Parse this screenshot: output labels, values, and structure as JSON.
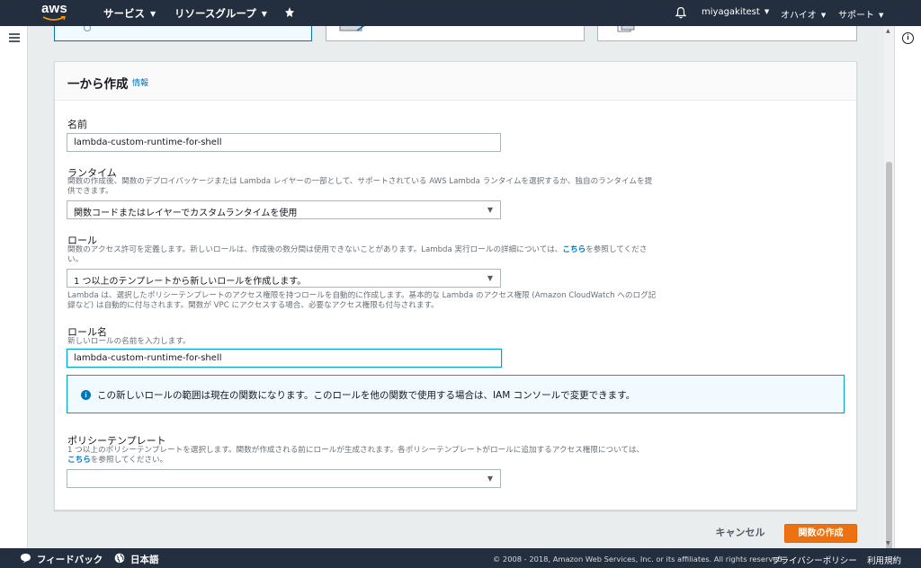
{
  "topnav": {
    "logo": "aws",
    "services": "サービス",
    "resource_groups": "リソースグループ",
    "account": "miyagakitest",
    "region": "オハイオ",
    "support": "サポート"
  },
  "panel": {
    "title": "一から作成",
    "info_link": "情報"
  },
  "name_field": {
    "label": "名前",
    "value": "lambda-custom-runtime-for-shell"
  },
  "runtime_field": {
    "label": "ランタイム",
    "desc_line1": "関数の作成後、関数のデプロイパッケージまたは Lambda レイヤーの一部として、サポートされている AWS Lambda ランタイムを選択するか、独自のランタイムを提",
    "desc_line2": "供できます。",
    "selected": "関数コードまたはレイヤーでカスタムランタイムを使用"
  },
  "role_field": {
    "label": "ロール",
    "desc_line1_pre": "関数のアクセス許可を定義します。新しいロールは、作成後の数分間は使用できないことがあります。Lambda 実行ロールの詳細については、",
    "desc_link": "こちら",
    "desc_line1_post": "を参照してくださ",
    "desc_line2": "い。",
    "selected": "1 つ以上のテンプレートから新しいロールを作成します。",
    "note_line1": "Lambda は、選択したポリシーテンプレートのアクセス権限を持つロールを自動的に作成します。基本的な Lambda のアクセス権限 (Amazon CloudWatch へのログ記",
    "note_line2": "録など) は自動的に付与されます。関数が VPC にアクセスする場合、必要なアクセス権限も付与されます。"
  },
  "role_name_field": {
    "label": "ロール名",
    "desc": "新しいロールの名前を入力します。",
    "value": "lambda-custom-runtime-for-shell"
  },
  "alert": {
    "text": "この新しいロールの範囲は現在の関数になります。このロールを他の関数で使用する場合は、IAM コンソールで変更できます。"
  },
  "policy_field": {
    "label": "ポリシーテンプレート",
    "desc_line1": "1 つ以上のポリシーテンプレートを選択します。関数が作成される前にロールが生成されます。各ポリシーテンプレートがロールに追加するアクセス権限については、",
    "desc_link": "こちら",
    "desc_line2_post": "を参照してください。",
    "selected": ""
  },
  "actions": {
    "cancel": "キャンセル",
    "create": "関数の作成"
  },
  "footer": {
    "feedback": "フィードバック",
    "language": "日本語",
    "copyright": "© 2008 - 2018, Amazon Web Services, Inc. or its affiliates. All rights reserved.",
    "privacy": "プライバシーポリシー",
    "terms": "利用規約"
  },
  "colors": {
    "nav_bg": "#232f3e",
    "primary_button": "#ec7211",
    "link": "#0073bb",
    "focus": "#00a1c9"
  }
}
